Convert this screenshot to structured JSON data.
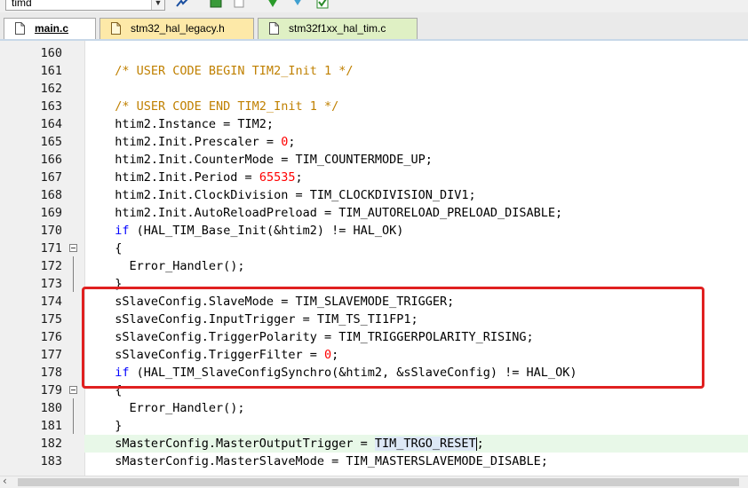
{
  "toolbar": {
    "target_combo_value": "timd"
  },
  "tabs": [
    {
      "label": "main.c",
      "active": true
    },
    {
      "label": "stm32_hal_legacy.h",
      "active": false
    },
    {
      "label": "stm32f1xx_hal_tim.c",
      "active": false
    }
  ],
  "editor": {
    "lines": [
      {
        "num": "160",
        "text": ""
      },
      {
        "num": "161",
        "text": "  /* USER CODE BEGIN TIM2_Init 1 */"
      },
      {
        "num": "162",
        "text": ""
      },
      {
        "num": "163",
        "text": "  /* USER CODE END TIM2_Init 1 */"
      },
      {
        "num": "164",
        "text": "  htim2.Instance = TIM2;"
      },
      {
        "num": "165",
        "text": "  htim2.Init.Prescaler = 0;"
      },
      {
        "num": "166",
        "text": "  htim2.Init.CounterMode = TIM_COUNTERMODE_UP;"
      },
      {
        "num": "167",
        "text": "  htim2.Init.Period = 65535;"
      },
      {
        "num": "168",
        "text": "  htim2.Init.ClockDivision = TIM_CLOCKDIVISION_DIV1;"
      },
      {
        "num": "169",
        "text": "  htim2.Init.AutoReloadPreload = TIM_AUTORELOAD_PRELOAD_DISABLE;"
      },
      {
        "num": "170",
        "text": "  if (HAL_TIM_Base_Init(&htim2) != HAL_OK)"
      },
      {
        "num": "171",
        "text": "  {"
      },
      {
        "num": "172",
        "text": "    Error_Handler();"
      },
      {
        "num": "173",
        "text": "  }"
      },
      {
        "num": "174",
        "text": "  sSlaveConfig.SlaveMode = TIM_SLAVEMODE_TRIGGER;"
      },
      {
        "num": "175",
        "text": "  sSlaveConfig.InputTrigger = TIM_TS_TI1FP1;"
      },
      {
        "num": "176",
        "text": "  sSlaveConfig.TriggerPolarity = TIM_TRIGGERPOLARITY_RISING;"
      },
      {
        "num": "177",
        "text": "  sSlaveConfig.TriggerFilter = 0;"
      },
      {
        "num": "178",
        "text": "  if (HAL_TIM_SlaveConfigSynchro(&htim2, &sSlaveConfig) != HAL_OK)"
      },
      {
        "num": "179",
        "text": "  {"
      },
      {
        "num": "180",
        "text": "    Error_Handler();"
      },
      {
        "num": "181",
        "text": "  }"
      },
      {
        "num": "182",
        "text": "  sMasterConfig.MasterOutputTrigger = TIM_TRGO_RESET;"
      },
      {
        "num": "183",
        "text": "  sMasterConfig.MasterSlaveMode = TIM_MASTERSLAVEMODE_DISABLE;"
      }
    ]
  },
  "colors": {
    "comment": "#c08000",
    "keyword": "#0000ff",
    "number": "#ff0000",
    "highlight_box": "#e02020",
    "current_line": "#e8f8e8"
  }
}
